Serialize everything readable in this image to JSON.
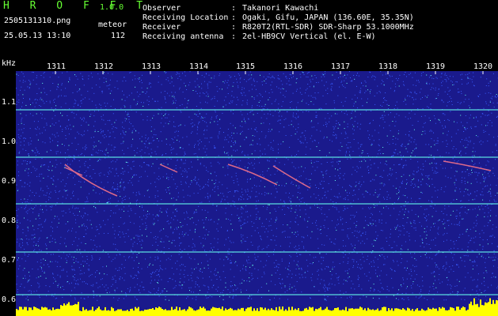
{
  "header": {
    "app_name": "H R O F F T",
    "version": "1.0.0",
    "file_name": "2505131310.png",
    "meteor_label": "meteor",
    "datetime": "25.05.13 13:10",
    "meteor_count": "112"
  },
  "station_info": [
    {
      "label": "Observer",
      "value": "Takanori Kawachi"
    },
    {
      "label": "Receiving Location",
      "value": "Ogaki, Gifu, JAPAN (136.60E, 35.35N)"
    },
    {
      "label": "Receiver",
      "value": "R820T2(RTL-SDR) SDR-Sharp 53.1000MHz"
    },
    {
      "label": "Receiving antenna",
      "value": "2el-HB9CV Vertical (el. E-W)"
    }
  ],
  "axis": {
    "y_unit": "kHz",
    "y_ticks": [
      "1.1",
      "1.0",
      "0.9",
      "0.8",
      "0.7",
      "0.6"
    ],
    "x_ticks": [
      "1311",
      "1312",
      "1313",
      "1314",
      "1315",
      "1316",
      "1317",
      "1318",
      "1319",
      "1320"
    ]
  },
  "colors": {
    "background": "#1a1a8c",
    "noise": "#3a5cff",
    "carrier": "#66ffee",
    "echo": "#ff7788",
    "power_bar": "#ffff00",
    "logo": "#66ff33"
  }
}
